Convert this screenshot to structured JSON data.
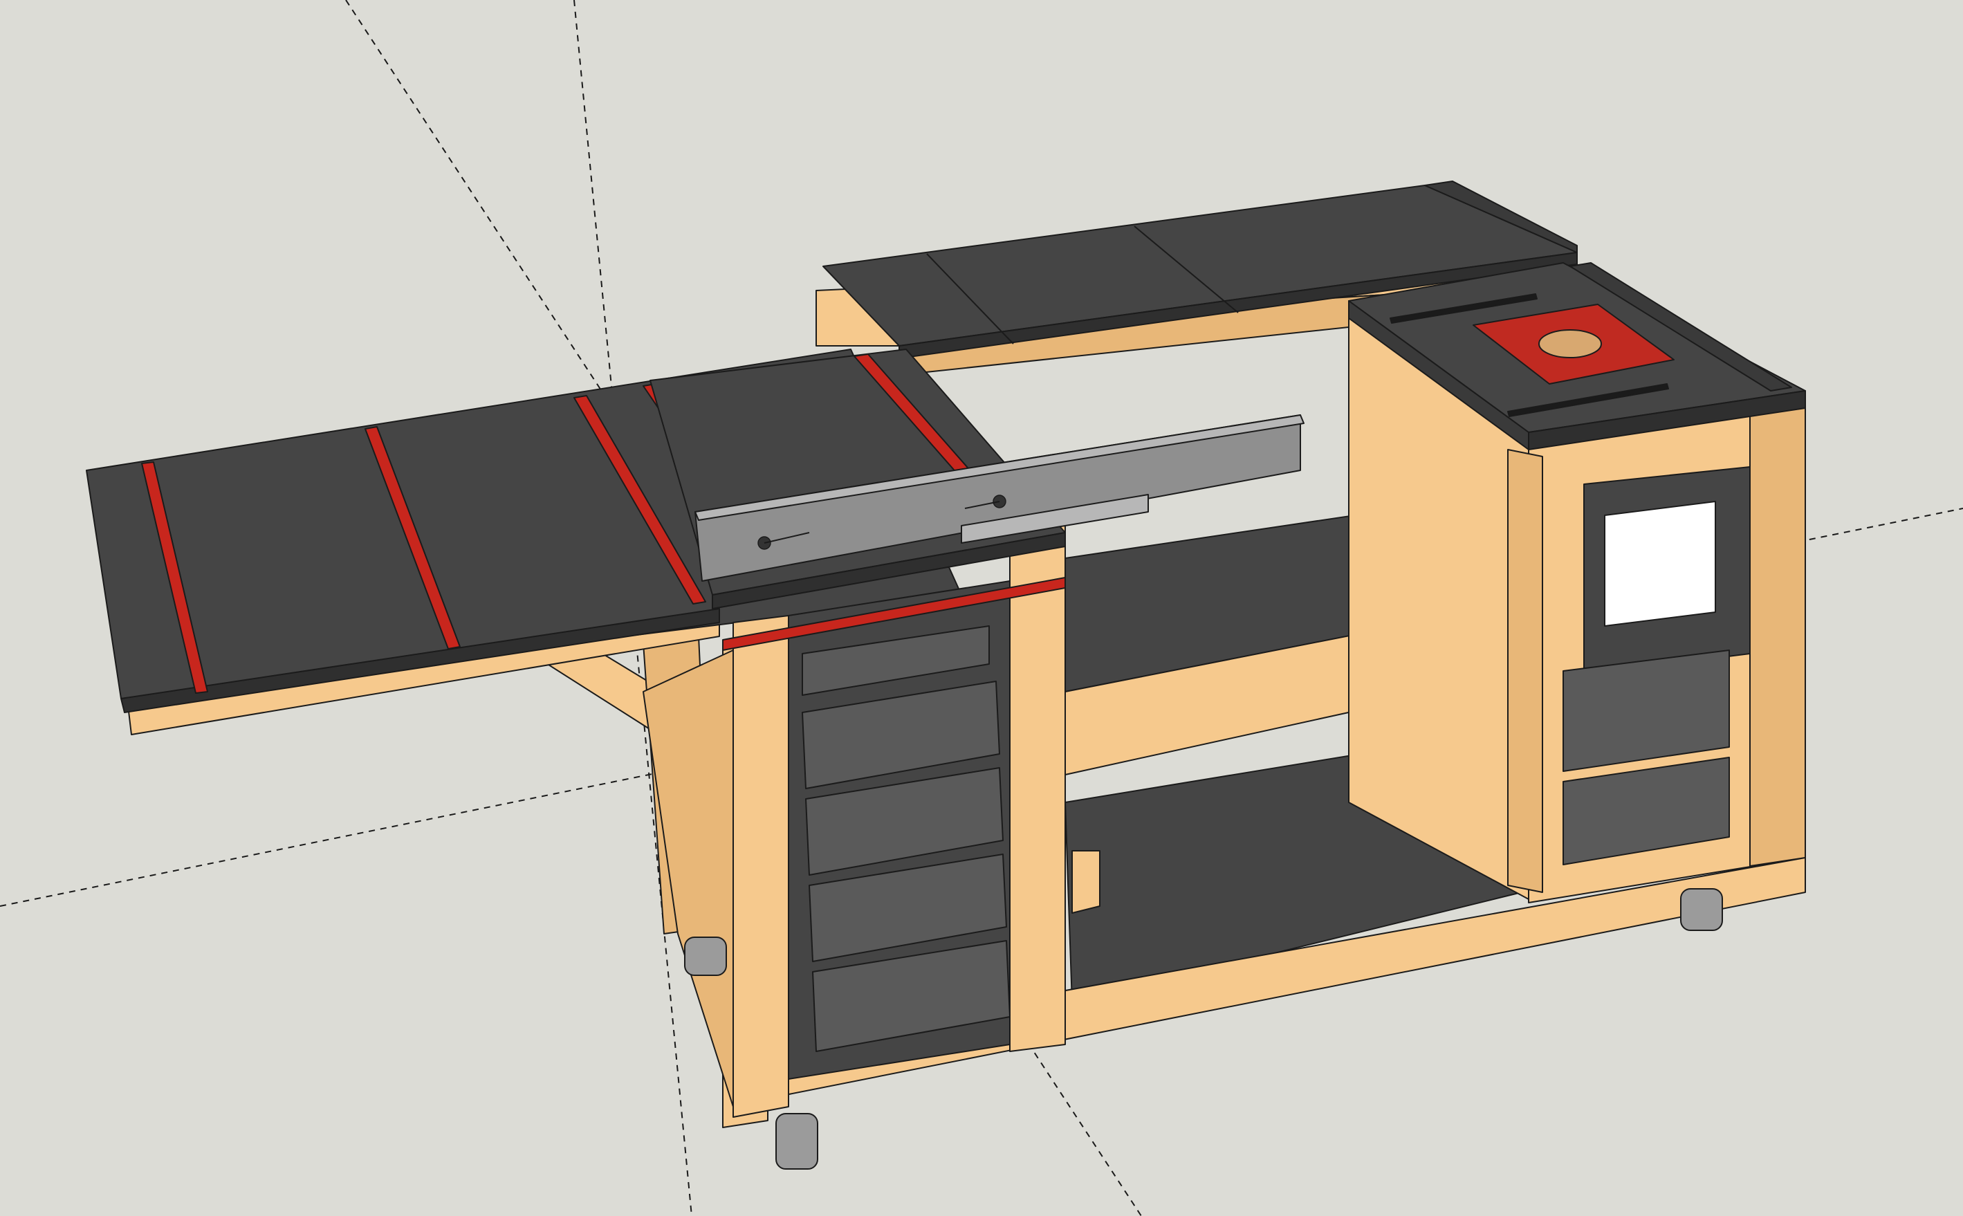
{
  "app": {
    "type": "3d-modeling-viewport",
    "scene": "workbench-model",
    "axes_visible": true
  },
  "colors": {
    "background": "#dcdcd6",
    "wood": "#f6c98d",
    "wood_shade": "#e8b778",
    "wood_dark": "#6b4e36",
    "top_surface": "#454545",
    "top_edge": "#2f2f2f",
    "drawer_front": "#5a5a5a",
    "t_track": "#c8261d",
    "router_plate": "#c02a21",
    "fence": "#8f8f8f",
    "fence_light": "#b7b7b7",
    "caster": "#9b9b9b",
    "window": "#ffffff",
    "axis_line": "#1a1a1a"
  },
  "icons": [
    "t-track-icon",
    "router-plate-icon",
    "fence-knob-icon",
    "caster-icon",
    "access-window-icon"
  ]
}
